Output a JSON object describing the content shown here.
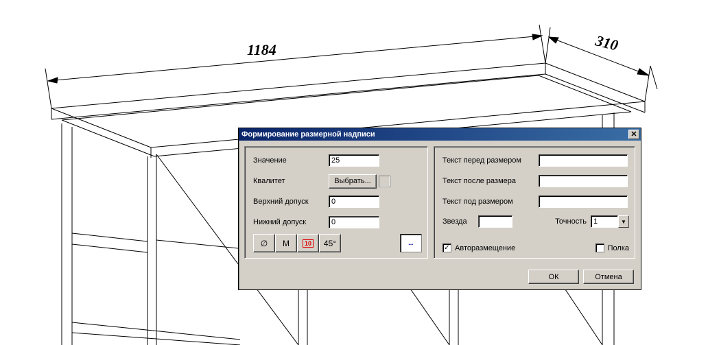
{
  "dimensions": {
    "dim1": "1184",
    "dim2": "310"
  },
  "dialog": {
    "title": "Формирование размерной надписи",
    "left": {
      "value_label": "Значение",
      "value": "25",
      "qualitet_label": "Квалитет",
      "choose_btn": "Выбрать...",
      "upper_label": "Верхний допуск",
      "upper": "0",
      "lower_label": "Нижний допуск",
      "lower": "0",
      "tool_diameter": "∅",
      "tool_m": "М",
      "tool_ten": "10",
      "tool_45": "45°",
      "tool_preview": "↔"
    },
    "right": {
      "text_before_label": "Текст перед размером",
      "text_before": "",
      "text_after_label": "Текст после размера",
      "text_after": "",
      "text_under_label": "Текст под размером",
      "text_under": "",
      "star_label": "Звезда",
      "star": "",
      "precision_label": "Точность",
      "precision": "1",
      "auto_label": "Авторазмещение",
      "auto_checked": "✓",
      "shelf_label": "Полка",
      "shelf_checked": ""
    },
    "footer": {
      "ok": "ОК",
      "cancel": "Отмена"
    }
  }
}
